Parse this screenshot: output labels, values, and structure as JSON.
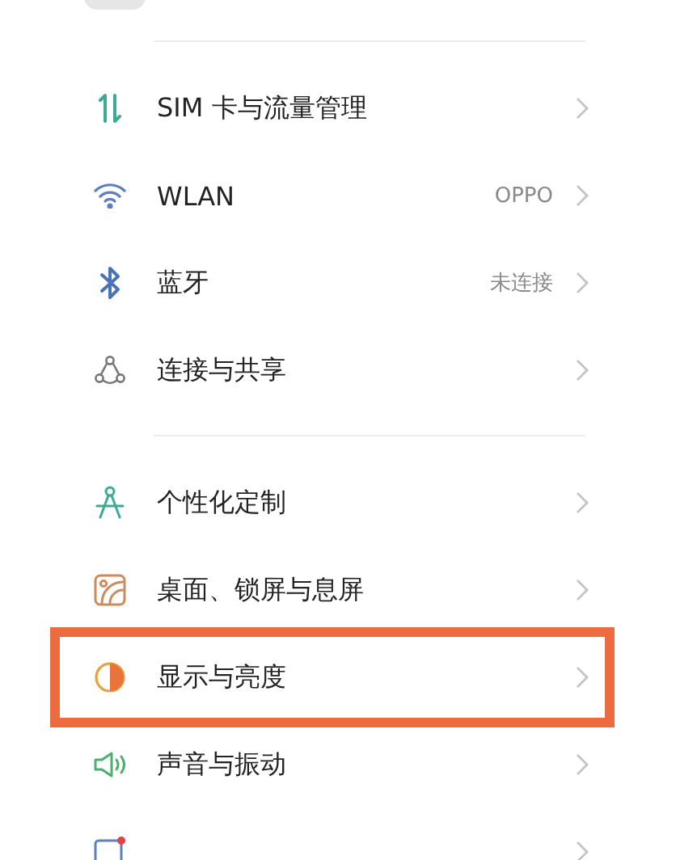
{
  "groups": [
    {
      "items": [
        {
          "label": "SIM 卡与流量管理",
          "highlighted": false
        },
        {
          "label": "WLAN",
          "value": "OPPO",
          "highlighted": false
        },
        {
          "label": "蓝牙",
          "value": "未连接",
          "highlighted": false
        },
        {
          "label": "连接与共享",
          "highlighted": false
        }
      ]
    },
    {
      "items": [
        {
          "label": "个性化定制",
          "highlighted": false
        },
        {
          "label": "桌面、锁屏与息屏",
          "highlighted": false
        },
        {
          "label": "显示与亮度",
          "highlighted": true
        },
        {
          "label": "声音与振动",
          "highlighted": false
        },
        {
          "highlighted": false
        }
      ]
    }
  ]
}
